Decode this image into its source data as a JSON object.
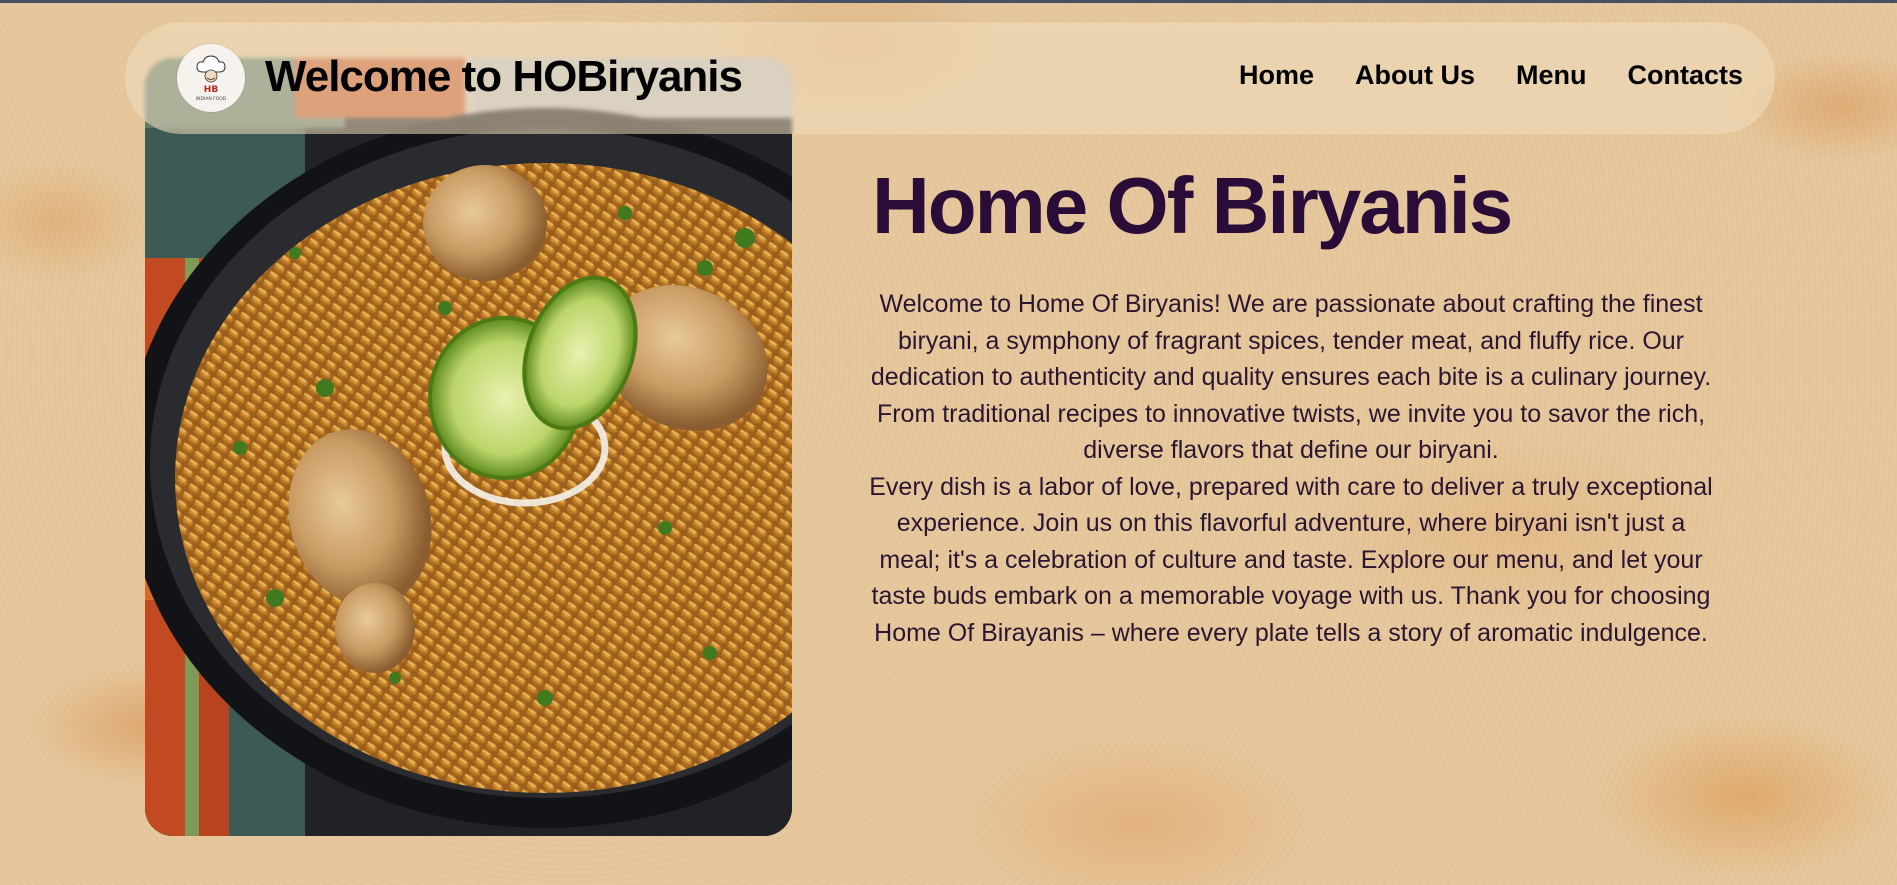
{
  "site": {
    "title": "Welcome to HOBiryanis",
    "logo": {
      "icon": "chef-logo-icon",
      "badge_text": "HB",
      "caption": "INDIAN FOOD"
    }
  },
  "nav": {
    "items": [
      {
        "label": "Home"
      },
      {
        "label": "About Us"
      },
      {
        "label": "Menu"
      },
      {
        "label": "Contacts"
      }
    ]
  },
  "hero": {
    "image_alt_icon": "biryani-dish-image",
    "headline": "Home Of Biryanis",
    "paragraph_1": "Welcome to Home Of Biryanis! We are passionate about crafting the finest biryani, a symphony of fragrant spices, tender meat, and fluffy rice. Our dedication to authenticity and quality ensures each bite is a culinary journey. From traditional recipes to innovative twists, we invite you to savor the rich, diverse flavors that define our biryani.",
    "paragraph_2": "Every dish is a labor of love, prepared with care to deliver a truly exceptional experience. Join us on this flavorful adventure, where biryani isn't just a meal; it's a celebration of culture and taste. Explore our menu, and let your taste buds embark on a memorable voyage with us. Thank you for choosing Home Of Birayanis  – where every plate tells a story of aromatic indulgence."
  },
  "colors": {
    "background": "#e6c79c",
    "headline": "#2a0c38",
    "body_text": "#2a1630",
    "nav_text": "#000000"
  }
}
